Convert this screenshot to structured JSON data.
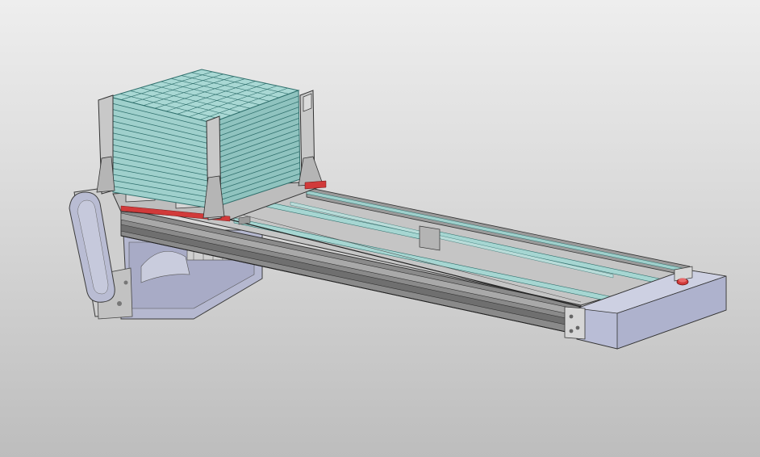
{
  "scene": {
    "subject": "",
    "colors": {
      "background_top": "#eeeeee",
      "background_bottom": "#bdbdbd",
      "wafer": "#9fd0cc",
      "wafer_line": "#2f6f6c",
      "frame_metal": "#a9a9a9",
      "rail_dark": "#7b7b7b",
      "end_block": "#b9bdd6",
      "motor_housing": "#b5b8d0",
      "accent_red": "#d13a3a"
    }
  }
}
